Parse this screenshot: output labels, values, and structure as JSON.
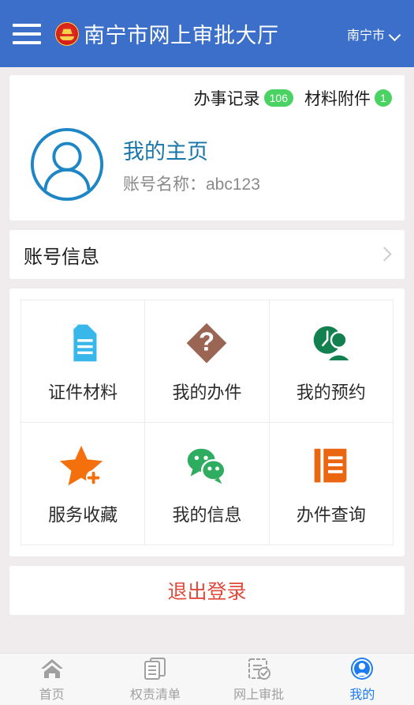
{
  "header": {
    "menu_icon": "hamburger-icon",
    "emblem_icon": "national-emblem-icon",
    "title": "南宁市网上审批大厅",
    "city": "南宁市",
    "city_chevron_icon": "chevron-down-icon",
    "background_color": "#3b6fc9"
  },
  "profile": {
    "stats": [
      {
        "label": "办事记录",
        "count": "106",
        "icon": "record-count-badge"
      },
      {
        "label": "材料附件",
        "count": "1",
        "icon": "attachment-count-badge"
      }
    ],
    "badge_color": "#4ad263",
    "avatar_icon": "user-avatar-icon",
    "avatar_color": "#1f86c6",
    "name": "我的主页",
    "name_color": "#1976a8",
    "account": "账号名称：abc123"
  },
  "account_info": {
    "label": "账号信息",
    "chevron_icon": "chevron-right-icon"
  },
  "grid": {
    "items": [
      {
        "label": "证件材料",
        "icon": "document-icon",
        "color": "#38b7ea"
      },
      {
        "label": "我的办件",
        "icon": "question-diamond-icon",
        "color": "#9a6553"
      },
      {
        "label": "我的预约",
        "icon": "clock-person-icon",
        "color": "#13804f"
      },
      {
        "label": "服务收藏",
        "icon": "star-plus-icon",
        "color": "#f3700d"
      },
      {
        "label": "我的信息",
        "icon": "chat-bubbles-icon",
        "color": "#2eac5f"
      },
      {
        "label": "办件查询",
        "icon": "book-icon",
        "color": "#ea6610"
      }
    ]
  },
  "logout": {
    "label": "退出登录",
    "color": "#e04a3c"
  },
  "tabbar": {
    "active_color": "#1d7cf2",
    "inactive_color": "#a0a0a0",
    "items": [
      {
        "label": "首页",
        "icon": "home-icon",
        "active": false
      },
      {
        "label": "权责清单",
        "icon": "list-document-icon",
        "active": false
      },
      {
        "label": "网上审批",
        "icon": "clipboard-check-icon",
        "active": false
      },
      {
        "label": "我的",
        "icon": "user-circle-icon",
        "active": true
      }
    ]
  },
  "background_color": "#f0eced"
}
